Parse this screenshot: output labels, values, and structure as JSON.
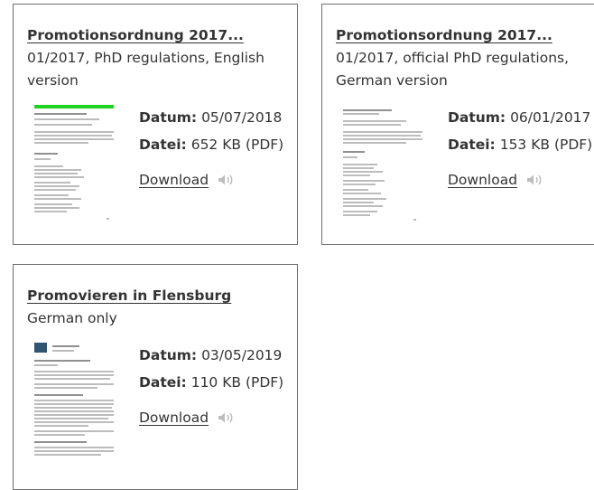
{
  "documents": [
    {
      "title": "Promotionsordnung 2017...",
      "description": "01/2017, PhD regulations, English version",
      "datum_label": "Datum:",
      "datum_value": "05/07/2018",
      "datei_label": "Datei:",
      "datei_value": "652 KB (PDF)",
      "download_label": "Download"
    },
    {
      "title": "Promotionsordnung 2017...",
      "description": "01/2017, official PhD regulations, German version",
      "datum_label": "Datum:",
      "datum_value": "06/01/2017",
      "datei_label": "Datei:",
      "datei_value": "153 KB (PDF)",
      "download_label": "Download"
    },
    {
      "title": "Promovieren in Flensburg",
      "description": "German only",
      "datum_label": "Datum:",
      "datum_value": "03/05/2019",
      "datei_label": "Datei:",
      "datei_value": "110 KB (PDF)",
      "download_label": "Download"
    }
  ],
  "icons": {
    "speaker": "speaker-icon",
    "thumbnail": "pdf-thumbnail"
  },
  "colors": {
    "border": "#6f6f6f",
    "text": "#333333",
    "thumbnail_highlight": "#21d321",
    "speaker_icon": "#bdbdbd"
  }
}
